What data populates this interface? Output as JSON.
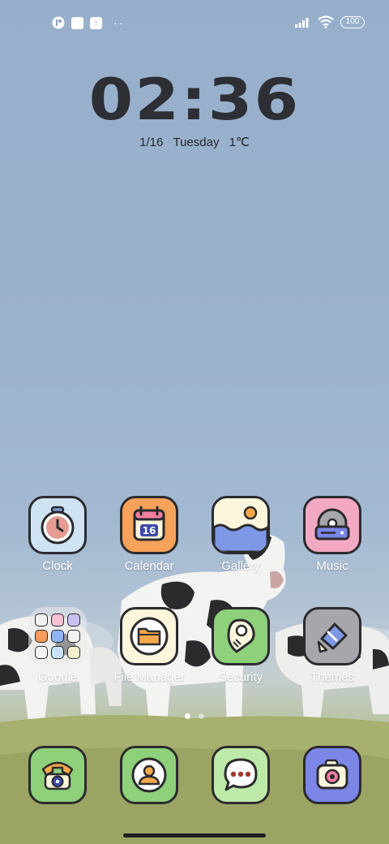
{
  "status_bar": {
    "left_icons": [
      "notification-icon",
      "square-icon",
      "upload-icon"
    ],
    "overflow": "··",
    "right_icons": [
      "signal-icon",
      "wifi-icon"
    ],
    "battery": "100"
  },
  "clock_widget": {
    "time": "02:36",
    "date": "1/16",
    "weekday": "Tuesday",
    "temperature": "1℃"
  },
  "apps": [
    {
      "label": "Clock",
      "icon": "clock-icon",
      "bg": "#cfe3f3"
    },
    {
      "label": "Calendar",
      "icon": "calendar-icon",
      "bg": "#f7a25a",
      "badge": "16"
    },
    {
      "label": "Gallery",
      "icon": "gallery-icon",
      "bg": "#fbf6dc"
    },
    {
      "label": "Music",
      "icon": "music-icon",
      "bg": "#f3a9c4"
    },
    {
      "label": "Google",
      "icon": "folder-icon"
    },
    {
      "label": "File Manager",
      "icon": "file-manager-icon",
      "bg": "#fbf6dc"
    },
    {
      "label": "Security",
      "icon": "security-icon",
      "bg": "#8fd07b"
    },
    {
      "label": "Themes",
      "icon": "themes-icon",
      "bg": "#a7a7ab"
    }
  ],
  "dock": [
    {
      "icon": "phone-icon",
      "bg": "#8fd07b"
    },
    {
      "icon": "contacts-icon",
      "bg": "#8fd07b"
    },
    {
      "icon": "messages-icon",
      "bg": "#bdeaa9"
    },
    {
      "icon": "camera-icon",
      "bg": "#7b86e6"
    }
  ],
  "folder_mini_colors": [
    "#f1f1f1",
    "#f6c1d2",
    "#c9c1f3",
    "#f79b5b",
    "#8fb5f6",
    "#f3f3f3",
    "#f3f3f3",
    "#c8e3f5",
    "#f3efd0"
  ],
  "page_indicator": {
    "pages": 2,
    "current": 1
  }
}
